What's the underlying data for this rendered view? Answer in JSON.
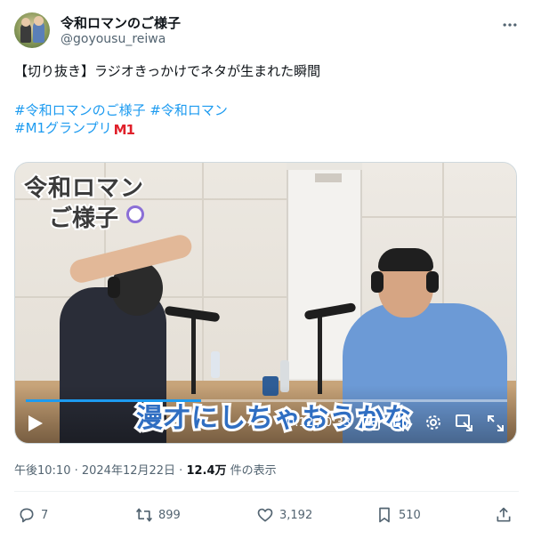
{
  "account": {
    "name": "令和ロマンのご様子",
    "handle": "@goyousu_reiwa"
  },
  "tweet": {
    "line1": "【切り抜き】ラジオきっかけでネタが生まれた瞬間",
    "hashtags_line1": [
      "#令和ロマンのご様子",
      "#令和ロマン"
    ],
    "hashtags_line2": "#M1グランプリ",
    "m1_badge": "M1"
  },
  "video": {
    "logo_line1": "令和ロマン",
    "logo_line2": "ご様子",
    "caption": "漫才にしちゃおうかな",
    "time": "0:12 / 0:33",
    "progress": 0.3636,
    "accent_color": "#1d9bf0",
    "caption_color": "#2f6ec2"
  },
  "meta": {
    "timestamp": "午後10:10 · 2024年12月22日 · ",
    "views_count": "12.4万",
    "views_label": " 件の表示"
  },
  "actions": {
    "replies": "7",
    "reposts": "899",
    "likes": "3,192",
    "bookmarks": "510"
  },
  "icons": [
    "more-icon",
    "play-icon",
    "cc-icon",
    "volume-icon",
    "gear-icon",
    "popout-icon",
    "fullscreen-icon",
    "reply-icon",
    "repost-icon",
    "like-icon",
    "bookmark-icon",
    "share-icon"
  ]
}
